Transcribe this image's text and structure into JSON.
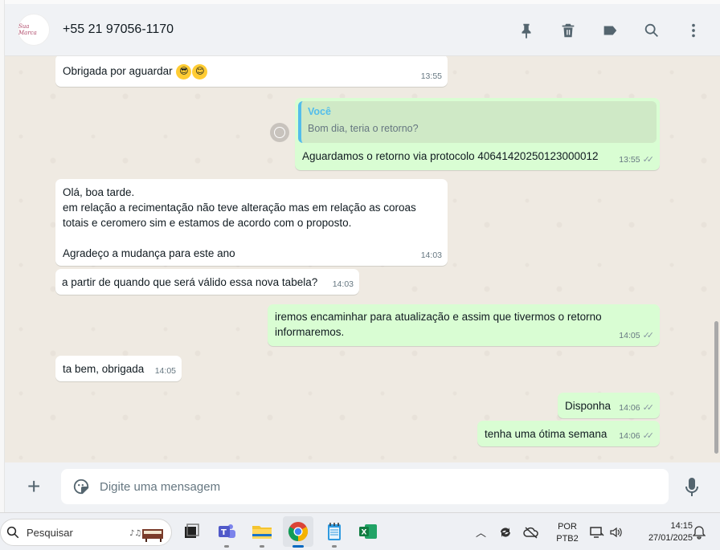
{
  "header": {
    "contact_name": "+55 21 97056-1170",
    "avatar_text": "Sua Marca",
    "icons": [
      "pin-icon",
      "delete-icon",
      "label-icon",
      "search-icon",
      "menu-icon"
    ]
  },
  "messages": [
    {
      "dir": "in",
      "text": "Obrigada por aguardar",
      "time": "13:55",
      "emoji": [
        "sunglasses-face",
        "smiling-face"
      ]
    },
    {
      "dir": "out",
      "quote_author": "Você",
      "quote_text": "Bom dia, teria o retorno?",
      "text": "Aguardamos o retorno via protocolo 40641420250123000012",
      "time": "13:55",
      "status": "delivered"
    },
    {
      "dir": "in",
      "lines": [
        "Olá, boa tarde.",
        "em relação a recimentação não teve alteração mas em relação as coroas",
        "totais e ceromero sim e estamos de acordo com o proposto.",
        "",
        "Agradeço  a mudança para este ano"
      ],
      "time": "14:03"
    },
    {
      "dir": "in",
      "text": "a partir de quando que será válido essa nova tabela?",
      "time": "14:03"
    },
    {
      "dir": "out",
      "lines": [
        "iremos encaminhar para atualização e assim que tivermos o retorno",
        "informaremos."
      ],
      "time": "14:05",
      "status": "delivered"
    },
    {
      "dir": "in",
      "text": "ta bem, obrigada",
      "time": "14:05"
    },
    {
      "dir": "out",
      "text": "Disponha",
      "time": "14:06",
      "status": "delivered"
    },
    {
      "dir": "out",
      "text": "tenha uma ótima semana",
      "time": "14:06",
      "status": "delivered"
    }
  ],
  "composer": {
    "placeholder": "Digite uma mensagem"
  },
  "taskbar": {
    "search_label": "Pesquisar",
    "apps": [
      "task-view",
      "teams",
      "file-explorer",
      "chrome",
      "notepad",
      "excel"
    ],
    "active_app": "chrome",
    "lang_line1": "POR",
    "lang_line2": "PTB2",
    "time": "14:15",
    "date": "27/01/2025"
  },
  "colors": {
    "chat_bg": "#efeae2",
    "outgoing_bubble": "#d9fdd3",
    "incoming_bubble": "#ffffff",
    "quote_author": "#53bdeb",
    "header_bg": "#f0f2f5"
  }
}
